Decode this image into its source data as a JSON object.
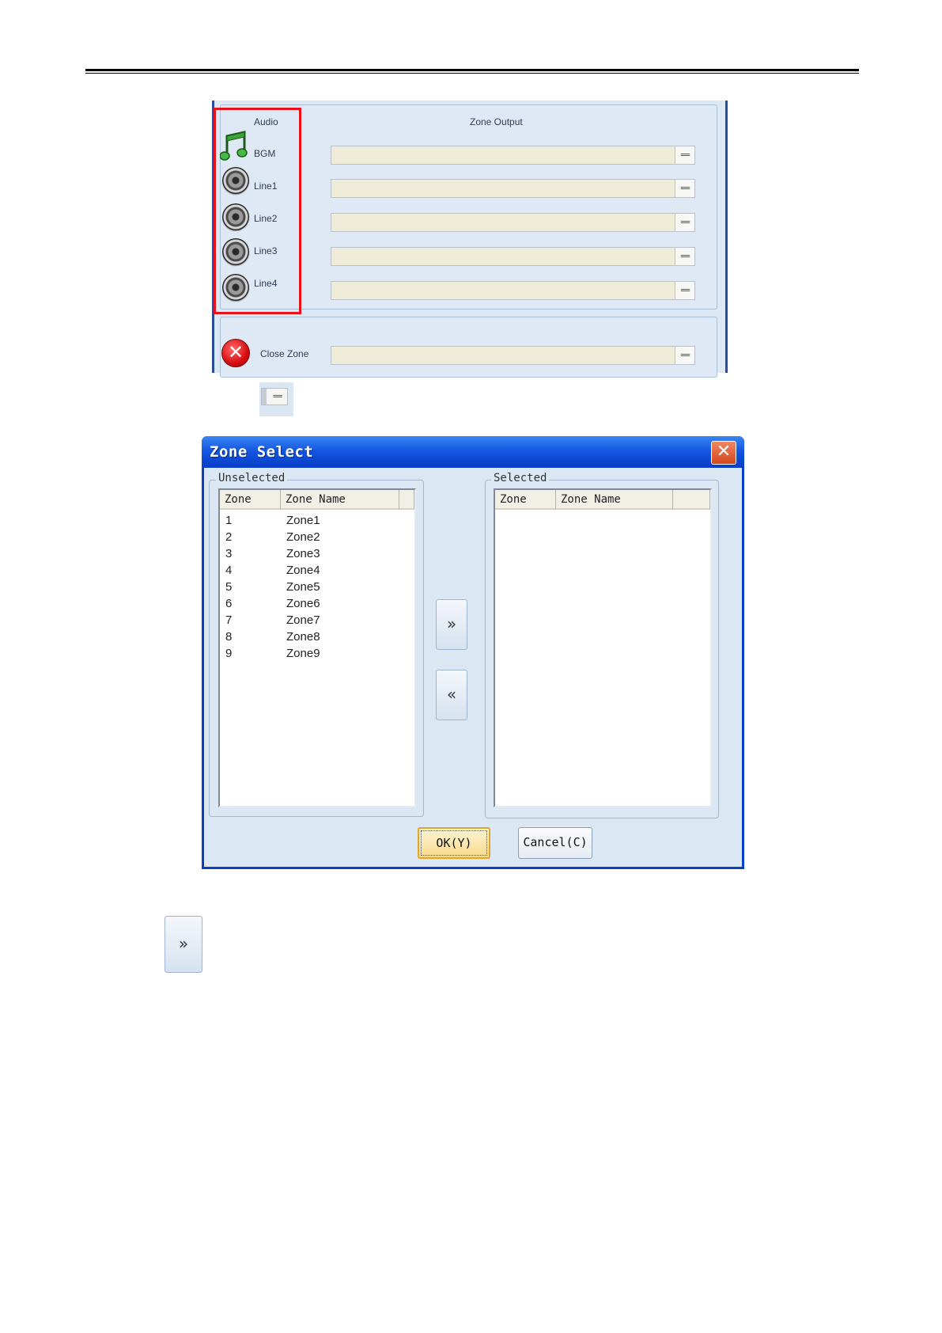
{
  "zone_output_panel": {
    "audio_header": "Audio",
    "zone_output_header": "Zone Output",
    "sources": [
      {
        "label": "BGM",
        "icon": "music-note-icon"
      },
      {
        "label": "Line1",
        "icon": "speaker-icon"
      },
      {
        "label": "Line2",
        "icon": "speaker-icon"
      },
      {
        "label": "Line3",
        "icon": "speaker-icon"
      },
      {
        "label": "Line4",
        "icon": "speaker-icon"
      }
    ],
    "select_button_label": "==",
    "close_zone_label": "Close Zone",
    "highlight_color": "#e8101a"
  },
  "standalone_select_icon": {
    "label": "=="
  },
  "dialog": {
    "title": "Zone Select",
    "close_glyph": "✕",
    "unselected_legend": "Unselected",
    "selected_legend": "Selected",
    "columns": [
      "Zone",
      "Zone Name"
    ],
    "unselected_rows": [
      {
        "zone": "1",
        "name": "Zone1"
      },
      {
        "zone": "2",
        "name": "Zone2"
      },
      {
        "zone": "3",
        "name": "Zone3"
      },
      {
        "zone": "4",
        "name": "Zone4"
      },
      {
        "zone": "5",
        "name": "Zone5"
      },
      {
        "zone": "6",
        "name": "Zone6"
      },
      {
        "zone": "7",
        "name": "Zone7"
      },
      {
        "zone": "8",
        "name": "Zone8"
      },
      {
        "zone": "9",
        "name": "Zone9"
      }
    ],
    "selected_rows": [],
    "add_button": "»",
    "remove_button": "«",
    "ok_button": "OK(Y)",
    "cancel_button": "Cancel(C)",
    "title_bar_color": "#0b46d0"
  },
  "standalone_add_button": {
    "label": "»"
  }
}
